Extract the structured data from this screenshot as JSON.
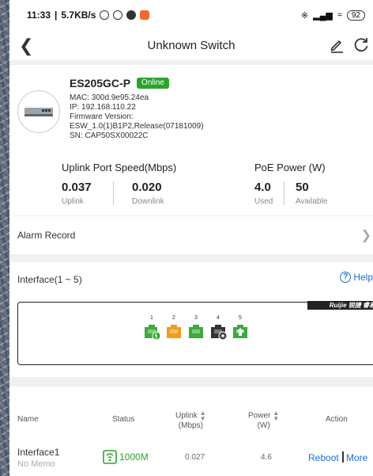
{
  "status_bar": {
    "time": "11:33",
    "speed": "5.7KB/s",
    "battery": "92"
  },
  "titlebar": {
    "title": "Unknown Switch"
  },
  "device": {
    "model": "ES205GC-P",
    "status": "Online",
    "mac": "MAC: 300d.9e95.24ea",
    "ip": "IP: 192.168.110.22",
    "firmware_label": "Firmware Version:",
    "firmware_value": "ESW_1.0(1)B1P2,Release(07181009)",
    "sn": "SN: CAP50SX00022C"
  },
  "uplink_speed": {
    "label": "Uplink Port Speed(Mbps)",
    "uplink_value": "0.037",
    "uplink_label": "Uplink",
    "downlink_value": "0.020",
    "downlink_label": "Downlink"
  },
  "poe": {
    "label": "PoE Power (W)",
    "used_value": "4.0",
    "used_label": "Used",
    "available_value": "50",
    "available_label": "Available"
  },
  "alarm": {
    "label": "Alarm Record"
  },
  "interface": {
    "header": "Interface(1 ~ 5)",
    "help_label": "Help",
    "brand": "Ruijie 锐捷 睿易",
    "ports": [
      {
        "num": "1",
        "color": "#3bab3b",
        "badge": "power"
      },
      {
        "num": "2",
        "color": "#f39c1b",
        "badge": ""
      },
      {
        "num": "3",
        "color": "#3bab3b",
        "badge": ""
      },
      {
        "num": "4",
        "color": "#333333",
        "badge": "gear"
      },
      {
        "num": "5",
        "color": "#3bab3b",
        "badge": "uplink"
      }
    ]
  },
  "table": {
    "headers": {
      "name": "Name",
      "status": "Status",
      "uplink": "Uplink",
      "uplink_unit": "(Mbps)",
      "power": "Power",
      "power_unit": "(W)",
      "action": "Action"
    },
    "rows": [
      {
        "name": "Interface1",
        "memo": "No Memo",
        "status": "1000M",
        "uplink": "0.027",
        "power": "4.6",
        "reboot": "Reboot",
        "more": "More"
      }
    ]
  },
  "colors": {
    "online": "#2aa52a",
    "link": "#1e6ed8"
  }
}
